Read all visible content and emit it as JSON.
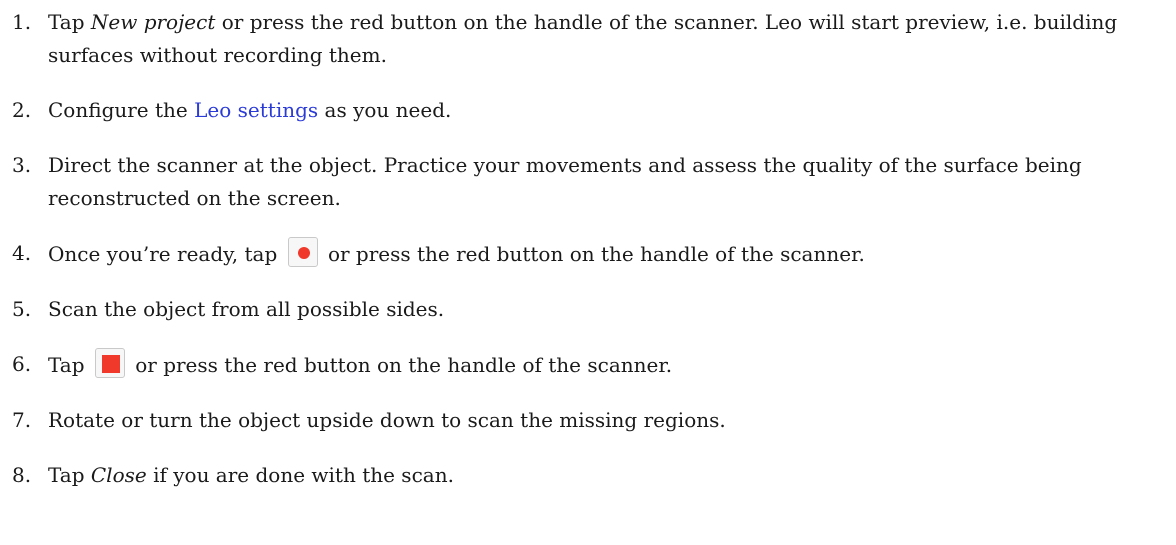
{
  "steps": [
    {
      "num": "1.",
      "parts": [
        {
          "t": "Tap "
        },
        {
          "t": "New project",
          "em": true
        },
        {
          "t": " or press the red button on the handle of the scanner. Leo will start preview, i.e. building surfaces without recording them."
        }
      ]
    },
    {
      "num": "2.",
      "parts": [
        {
          "t": "Configure the "
        },
        {
          "t": "Leo settings",
          "link": true
        },
        {
          "t": " as you need."
        }
      ]
    },
    {
      "num": "3.",
      "parts": [
        {
          "t": "Direct the scanner at the object. Practice your movements and assess the quality of the surface being reconstructed on the screen."
        }
      ]
    },
    {
      "num": "4.",
      "parts": [
        {
          "t": "Once you’re ready, tap "
        },
        {
          "icon": "record-icon"
        },
        {
          "t": " or press the red button on the handle of the scanner."
        }
      ]
    },
    {
      "num": "5.",
      "parts": [
        {
          "t": "Scan the object from all possible sides."
        }
      ]
    },
    {
      "num": "6.",
      "parts": [
        {
          "t": "Tap "
        },
        {
          "icon": "stop-icon"
        },
        {
          "t": " or press the red button on the handle of the scanner."
        }
      ]
    },
    {
      "num": "7.",
      "parts": [
        {
          "t": "Rotate or turn the object upside down to scan the missing regions."
        }
      ]
    },
    {
      "num": "8.",
      "parts": [
        {
          "t": "Tap "
        },
        {
          "t": "Close",
          "em": true
        },
        {
          "t": " if you are done with the scan."
        }
      ]
    }
  ],
  "colors": {
    "link": "#2b3bd6",
    "record": "#f0392b",
    "stop": "#f0392b"
  }
}
